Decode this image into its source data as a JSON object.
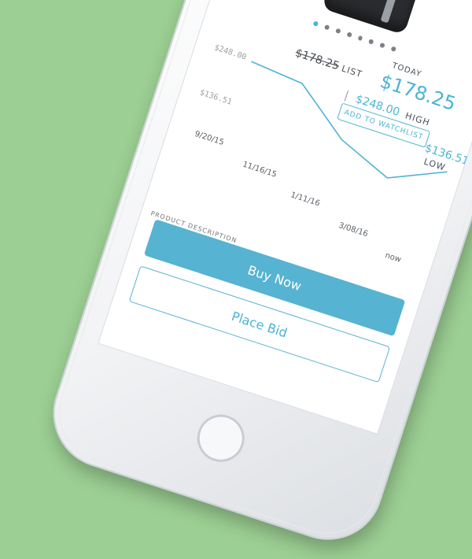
{
  "product": {
    "image": "black-bag-photo",
    "carousel": {
      "count": 8,
      "active_index": 0
    }
  },
  "pricing": {
    "list_price": "$178.25",
    "list_label": "LIST",
    "today_label": "TODAY",
    "today_price": "$178.25",
    "separator": "|",
    "high_price": "$248.00",
    "high_label": "HIGH",
    "low_price": "$136.51",
    "low_label": "LOW"
  },
  "watchlist_button": {
    "label": "ADD TO WATCHLIST"
  },
  "price_chart": {
    "y_ticks": [
      "$248.00",
      "$136.51"
    ],
    "x_ticks": [
      "9/20/15",
      "11/16/15",
      "1/11/16",
      "3/08/16",
      "now"
    ],
    "line_color": "#4bb4d3"
  },
  "chart_data": {
    "type": "line",
    "x": [
      "9/20/15",
      "11/16/15",
      "1/11/16",
      "3/08/16",
      "now"
    ],
    "series": [
      {
        "values": [
          248.0,
          240.0,
          175.0,
          140.0,
          178.25
        ]
      }
    ],
    "ylim": [
      136.51,
      248.0
    ]
  },
  "actions": {
    "buy_now": "Buy Now",
    "place_bid": "Place Bid"
  },
  "section": {
    "description_label": "PRODUCT DESCRIPTION"
  },
  "colors": {
    "accent": "#4bb4d3",
    "background": "#9ccf93",
    "button_fill": "#56b3d1"
  }
}
